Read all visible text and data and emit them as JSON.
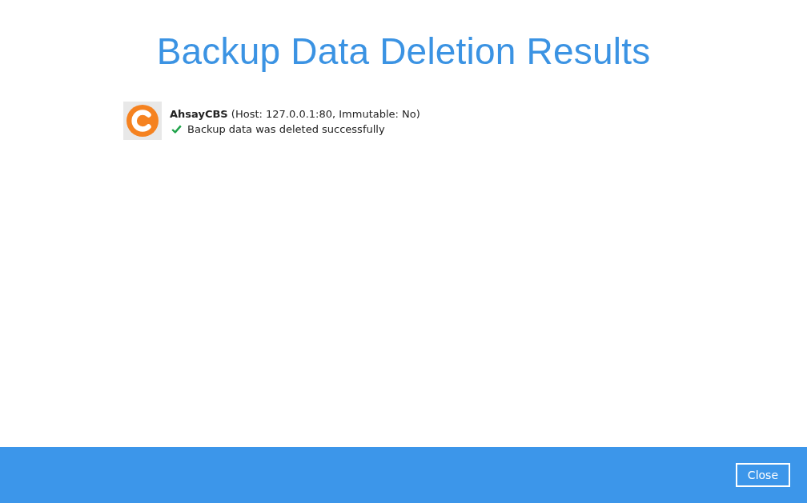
{
  "title": "Backup Data Deletion Results",
  "results": [
    {
      "heading": "**AhsayCBS** (Host: 127.0.0.1:80, Immutable: No)",
      "status": "Backup data was deleted successfully",
      "kind": "success"
    }
  ],
  "footer": {
    "buttons": [
      {
        "label": "Close"
      }
    ]
  }
}
